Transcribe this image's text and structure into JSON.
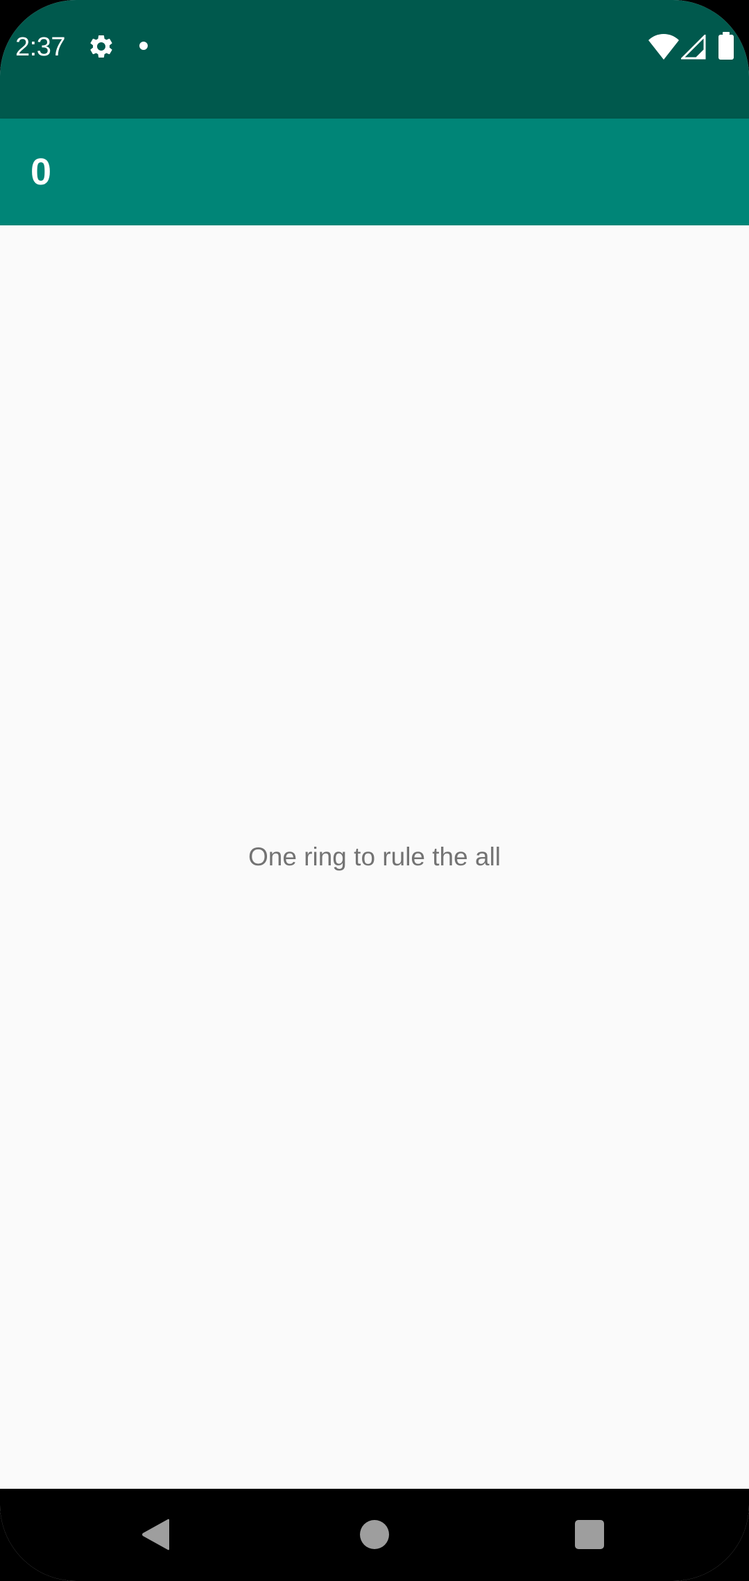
{
  "status_bar": {
    "time": "2:37",
    "icons": [
      "gear-icon",
      "notification-dot-icon",
      "wifi-icon",
      "cell-signal-icon",
      "battery-icon"
    ]
  },
  "app_bar": {
    "title": "0"
  },
  "main": {
    "message": "One ring to rule the all"
  },
  "nav_bar": {
    "icons": [
      "back-icon",
      "home-icon",
      "recents-icon"
    ]
  },
  "colors": {
    "status_bar": "#00594d",
    "app_bar": "#008577",
    "background": "#fafafa",
    "message_text": "#737373",
    "nav_bar": "#000000",
    "nav_icons": "#9e9e9e"
  }
}
